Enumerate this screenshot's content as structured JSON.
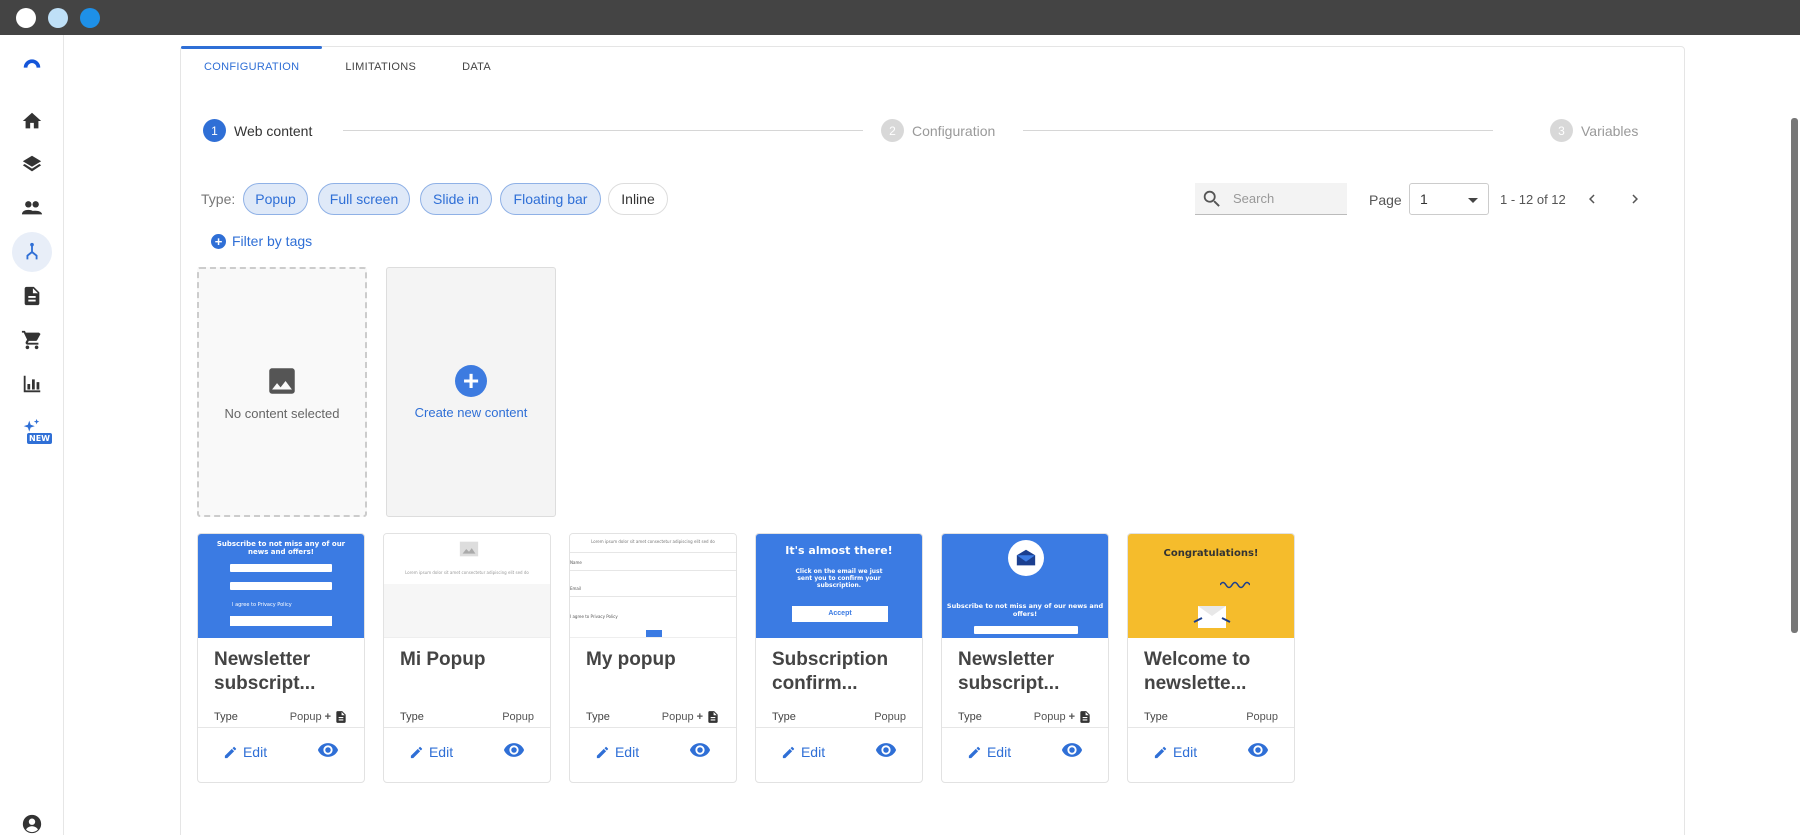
{
  "window": {
    "dots": [
      "#ffffff",
      "#bfe0f7",
      "#1e90e8"
    ]
  },
  "sidebar": {
    "items": [
      {
        "icon": "logo-icon"
      },
      {
        "icon": "home-icon"
      },
      {
        "icon": "layers-icon"
      },
      {
        "icon": "people-icon"
      },
      {
        "icon": "workflow-icon",
        "active": true
      },
      {
        "icon": "document-icon"
      },
      {
        "icon": "cart-icon"
      },
      {
        "icon": "bar-chart-icon"
      },
      {
        "icon": "sparkle-icon",
        "badge": "NEW"
      },
      {
        "icon": "account-icon"
      }
    ]
  },
  "tabs": [
    {
      "label": "CONFIGURATION",
      "active": true
    },
    {
      "label": "LIMITATIONS",
      "active": false
    },
    {
      "label": "DATA",
      "active": false
    }
  ],
  "stepper": [
    {
      "num": "1",
      "label": "Web content",
      "active": true
    },
    {
      "num": "2",
      "label": "Configuration",
      "active": false
    },
    {
      "num": "3",
      "label": "Variables",
      "active": false
    }
  ],
  "filters": {
    "type_label": "Type:",
    "chips": [
      {
        "label": "Popup",
        "selected": true
      },
      {
        "label": "Full screen",
        "selected": true
      },
      {
        "label": "Slide in",
        "selected": true
      },
      {
        "label": "Floating bar",
        "selected": true
      },
      {
        "label": "Inline",
        "selected": false
      }
    ],
    "filter_tags": "Filter by tags"
  },
  "search": {
    "placeholder": "Search"
  },
  "pagination": {
    "page_label": "Page",
    "current": "1",
    "range": "1 - 12 of 12"
  },
  "tiles": {
    "empty_label": "No content selected",
    "create_label": "Create new content"
  },
  "card_common": {
    "type_label": "Type",
    "edit_label": "Edit"
  },
  "cards": [
    {
      "title_line1": "Newsletter",
      "title_line2": "subscript...",
      "type": "Popup",
      "has_extra": true,
      "plus": "+",
      "thumb": {
        "heading": "Subscribe to not miss any of our news and offers!",
        "field1": "Write your name",
        "field2": "Write your email",
        "check": "I agree to Privacy Policy",
        "button": "Send"
      }
    },
    {
      "title_line1": "Mi Popup",
      "title_line2": "",
      "type": "Popup",
      "has_extra": false,
      "thumb": {
        "line": "Lorem ipsum dolor sit amet consectetur adipiscing elit sed do"
      }
    },
    {
      "title_line1": "My popup",
      "title_line2": "",
      "type": "Popup",
      "has_extra": true,
      "plus": "+",
      "thumb": {
        "line": "Lorem ipsum dolor sit amet consectetur adipiscing elit sed do",
        "f1": "Name",
        "f2": "Email",
        "check": "I agree to Privacy Policy",
        "button": "Subscribe"
      }
    },
    {
      "title_line1": "Subscription",
      "title_line2": "confirm...",
      "type": "Popup",
      "has_extra": false,
      "thumb": {
        "heading": "It's almost there!",
        "body": "Click on the email we just sent you to confirm your subscription.",
        "button": "Accept"
      }
    },
    {
      "title_line1": "Newsletter",
      "title_line2": "subscript...",
      "type": "Popup",
      "has_extra": true,
      "plus": "+",
      "thumb": {
        "heading": "Subscribe to not miss any of our news and offers!",
        "field1": "Write your name"
      }
    },
    {
      "title_line1": "Welcome to",
      "title_line2": "newslette...",
      "type": "Popup",
      "has_extra": false,
      "thumb": {
        "heading": "Congratulations!"
      }
    }
  ],
  "colors": {
    "accent": "#2f6fd6",
    "chip_bg": "#dfe9f8",
    "thumb_blue": "#3b7be3",
    "thumb_yellow": "#f5bc2c"
  }
}
